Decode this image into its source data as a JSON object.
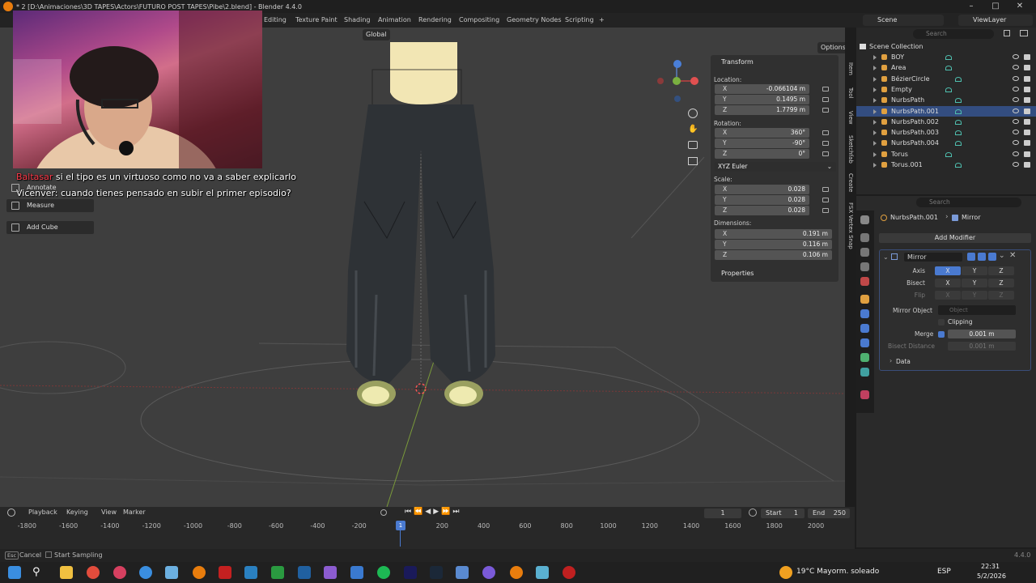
{
  "window": {
    "title": "* 2 [D:\\Animaciones\\3D TAPES\\Actors\\FUTURO POST TAPES\\Pibe\\2.blend] - Blender 4.4.0"
  },
  "workspaces": [
    "Editing",
    "Texture Paint",
    "Shading",
    "Animation",
    "Rendering",
    "Compositing",
    "Geometry Nodes",
    "Scripting",
    "+"
  ],
  "scene": {
    "scene_name": "Scene",
    "view_layer": "ViewLayer"
  },
  "viewport": {
    "orientation": "Global",
    "options_label": "Options"
  },
  "chat": [
    {
      "user": "Baltasar",
      "message": "si el tipo es un virtuoso como no va a saber explicarlo",
      "user_color": "#ff3b4a"
    },
    {
      "user": "Vicenver:",
      "message": "cuando tienes pensado en subir el primer episodio?",
      "user_color": "#ffffff"
    }
  ],
  "tools": [
    {
      "label": "Annotate"
    },
    {
      "label": "Measure"
    },
    {
      "label": "Add Cube"
    }
  ],
  "npanel": {
    "transform_header": "Transform",
    "location_label": "Location:",
    "location": [
      {
        "axis": "X",
        "value": "-0.066104 m"
      },
      {
        "axis": "Y",
        "value": "0.1495 m"
      },
      {
        "axis": "Z",
        "value": "1.7799 m"
      }
    ],
    "rotation_label": "Rotation:",
    "rotation": [
      {
        "axis": "X",
        "value": "360°"
      },
      {
        "axis": "Y",
        "value": "-90°"
      },
      {
        "axis": "Z",
        "value": "0°"
      }
    ],
    "rotation_mode": "XYZ Euler",
    "scale_label": "Scale:",
    "scale": [
      {
        "axis": "X",
        "value": "0.028"
      },
      {
        "axis": "Y",
        "value": "0.028"
      },
      {
        "axis": "Z",
        "value": "0.028"
      }
    ],
    "dimensions_label": "Dimensions:",
    "dimensions": [
      {
        "axis": "X",
        "value": "0.191 m"
      },
      {
        "axis": "Y",
        "value": "0.116 m"
      },
      {
        "axis": "Z",
        "value": "0.106 m"
      }
    ],
    "properties_header": "Properties",
    "tabs": [
      "Item",
      "Tool",
      "View",
      "Sketchfab",
      "Create",
      "FSX Vertex Snap"
    ]
  },
  "outliner": {
    "search_placeholder": "Search",
    "collection": "Scene Collection",
    "items": [
      {
        "name": "BOY",
        "color": "#e0a040",
        "selected": false
      },
      {
        "name": "Area",
        "color": "#e0a040",
        "selected": false
      },
      {
        "name": "BézierCircle",
        "color": "#e0a040",
        "selected": false
      },
      {
        "name": "Empty",
        "color": "#e0a040",
        "selected": false
      },
      {
        "name": "NurbsPath",
        "color": "#e0a040",
        "selected": false
      },
      {
        "name": "NurbsPath.001",
        "color": "#e0a040",
        "selected": true
      },
      {
        "name": "NurbsPath.002",
        "color": "#e0a040",
        "selected": false
      },
      {
        "name": "NurbsPath.003",
        "color": "#e0a040",
        "selected": false
      },
      {
        "name": "NurbsPath.004",
        "color": "#e0a040",
        "selected": false
      },
      {
        "name": "Torus",
        "color": "#e0a040",
        "selected": false
      },
      {
        "name": "Torus.001",
        "color": "#e0a040",
        "selected": false
      }
    ]
  },
  "properties": {
    "search_placeholder": "Search",
    "breadcrumb_object": "NurbsPath.001",
    "breadcrumb_modifier": "Mirror",
    "add_modifier": "Add Modifier",
    "modifier_name": "Mirror",
    "axis_label": "Axis",
    "bisect_label": "Bisect",
    "flip_label": "Flip",
    "axes": [
      "X",
      "Y",
      "Z"
    ],
    "mirror_object_label": "Mirror Object",
    "mirror_object_placeholder": "Object",
    "clipping_label": "Clipping",
    "merge_label": "Merge",
    "merge_value": "0.001 m",
    "bisect_distance_label": "Bisect Distance",
    "bisect_distance_value": "0.001 m",
    "data_label": "Data"
  },
  "timeline": {
    "playback": "Playback",
    "keying": "Keying",
    "view": "View",
    "marker": "Marker",
    "current_frame": "1",
    "start_label": "Start",
    "start": "1",
    "end_label": "End",
    "end": "250",
    "ruler": [
      "-1800",
      "-1600",
      "-1400",
      "-1200",
      "-1000",
      "-800",
      "-600",
      "-400",
      "-200",
      "200",
      "400",
      "600",
      "800",
      "1000",
      "1200",
      "1400",
      "1600",
      "1800",
      "2000"
    ],
    "playhead": "1"
  },
  "statusbar": {
    "esc_key": "Esc",
    "cancel": "Cancel",
    "start_sampling": "Start Sampling",
    "version": "4.4.0"
  },
  "taskbar": {
    "weather": "19°C  Mayorm. soleado",
    "lang": "ESP",
    "time": "22:31",
    "date": "5/2/2026"
  }
}
